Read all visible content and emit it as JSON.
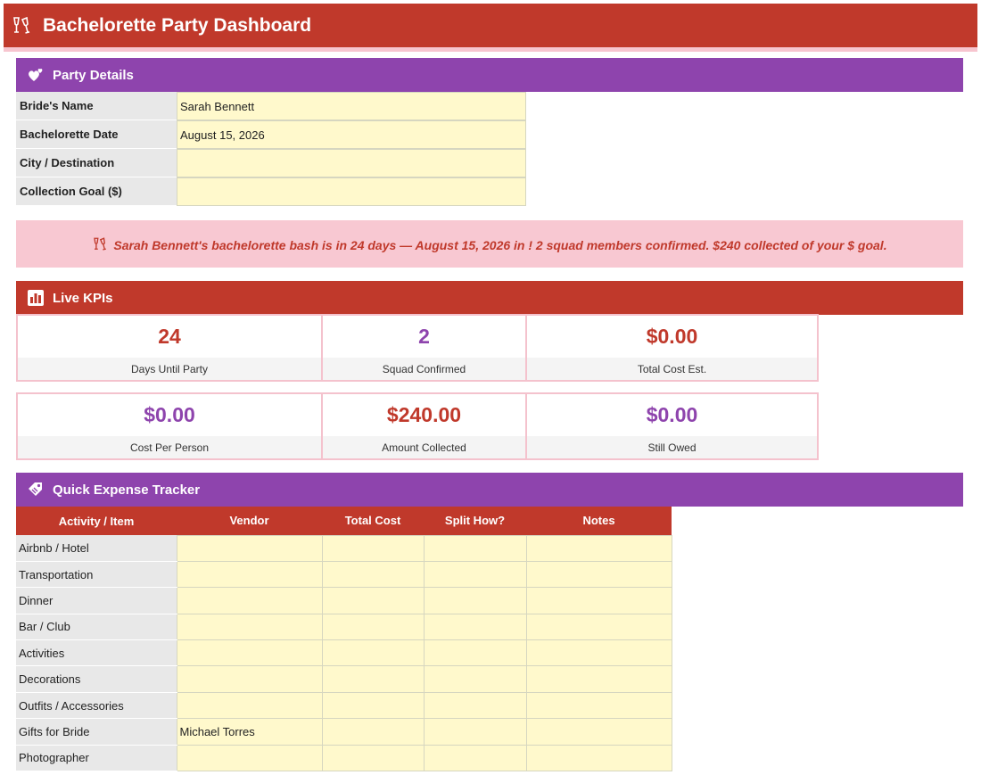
{
  "title": "Bachelorette Party Dashboard",
  "sections": {
    "party_details": "Party Details",
    "live_kpis": "Live KPIs",
    "expense_tracker": "Quick Expense Tracker"
  },
  "party_details": [
    {
      "label": "Bride's Name",
      "value": "Sarah Bennett"
    },
    {
      "label": "Bachelorette Date",
      "value": "August 15, 2026"
    },
    {
      "label": "City / Destination",
      "value": ""
    },
    {
      "label": "Collection Goal ($)",
      "value": ""
    }
  ],
  "banner": "Sarah Bennett's bachelorette bash is in 24 days — August 15, 2026 in !  2 squad members confirmed.  $240 collected of your $ goal.",
  "kpis": [
    {
      "value": "24",
      "label": "Days Until Party",
      "color": "#c0392b"
    },
    {
      "value": "2",
      "label": "Squad Confirmed",
      "color": "#8e44ad"
    },
    {
      "value": "$0.00",
      "label": "Total Cost Est.",
      "color": "#c0392b"
    },
    {
      "value": "$0.00",
      "label": "Cost Per Person",
      "color": "#8e44ad"
    },
    {
      "value": "$240.00",
      "label": "Amount Collected",
      "color": "#c0392b"
    },
    {
      "value": "$0.00",
      "label": "Still Owed",
      "color": "#8e44ad"
    }
  ],
  "tracker": {
    "headers": [
      "Activity / Item",
      "Vendor",
      "Total Cost",
      "Split How?",
      "Notes"
    ],
    "rows": [
      {
        "item": "Airbnb / Hotel",
        "vendor": "",
        "cost": "",
        "split": "",
        "notes": ""
      },
      {
        "item": "Transportation",
        "vendor": "",
        "cost": "",
        "split": "",
        "notes": ""
      },
      {
        "item": "Dinner",
        "vendor": "",
        "cost": "",
        "split": "",
        "notes": ""
      },
      {
        "item": "Bar / Club",
        "vendor": "",
        "cost": "",
        "split": "",
        "notes": ""
      },
      {
        "item": "Activities",
        "vendor": "",
        "cost": "",
        "split": "",
        "notes": ""
      },
      {
        "item": "Decorations",
        "vendor": "",
        "cost": "",
        "split": "",
        "notes": ""
      },
      {
        "item": "Outfits / Accessories",
        "vendor": "",
        "cost": "",
        "split": "",
        "notes": ""
      },
      {
        "item": "Gifts for Bride",
        "vendor": "Michael Torres",
        "cost": "",
        "split": "",
        "notes": ""
      },
      {
        "item": "Photographer",
        "vendor": "",
        "cost": "",
        "split": "",
        "notes": ""
      }
    ]
  },
  "colors": {
    "primary_red": "#c0392b",
    "purple": "#8e44ad",
    "pink": "#f8c8d2",
    "input_yellow": "#fff9cc"
  },
  "icons": {
    "title": "champagne-glasses-icon",
    "party_details": "hearts-icon",
    "live_kpis": "bar-chart-icon",
    "expense_tracker": "gift-tag-icon"
  }
}
